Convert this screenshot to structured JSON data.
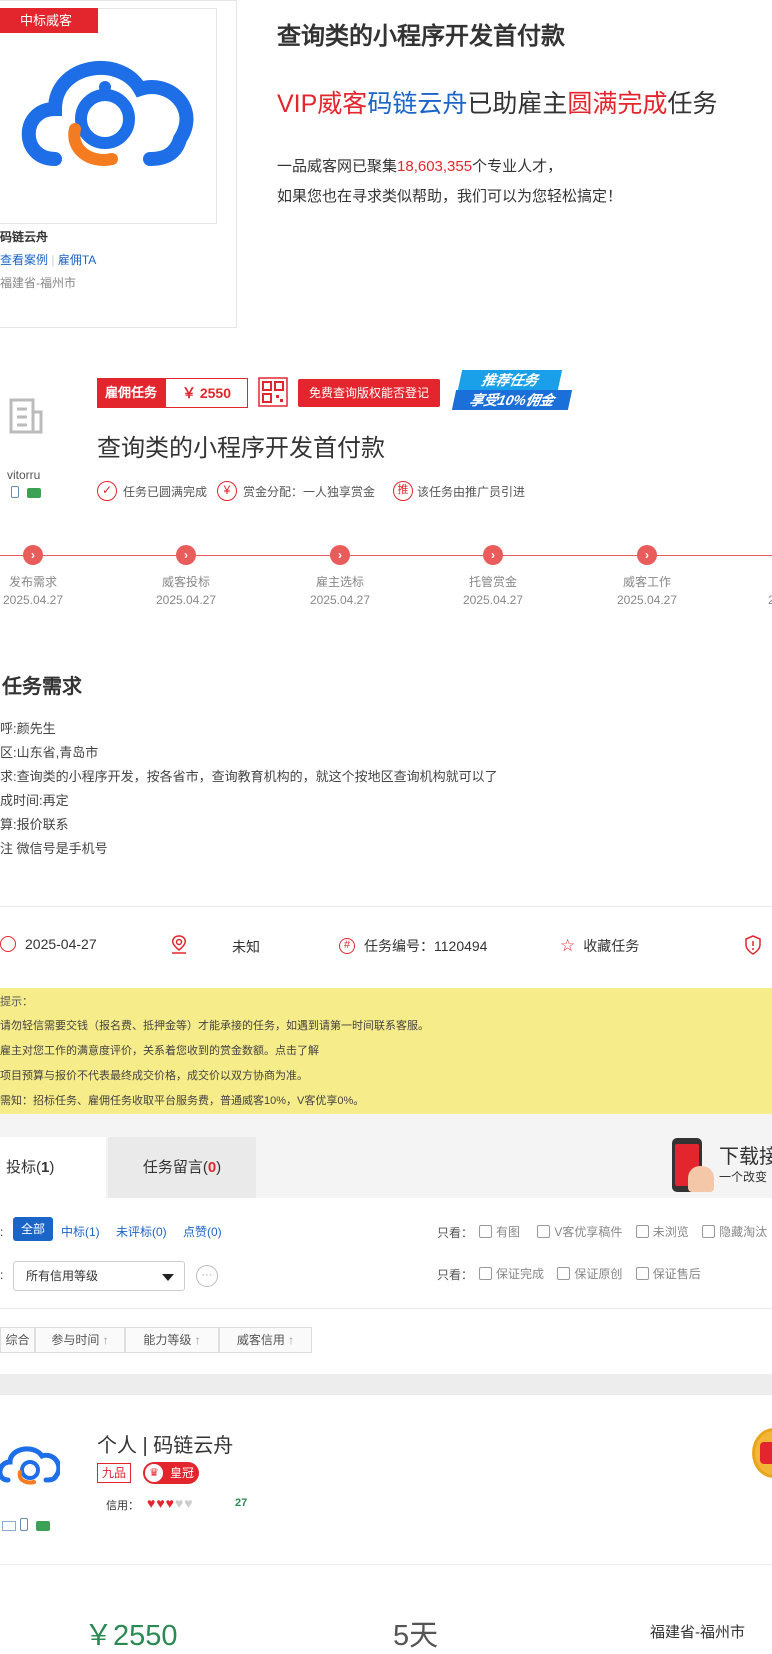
{
  "winner": {
    "badge": "中标威客",
    "name": "码链云舟",
    "view_cases": "查看案例",
    "separator": "|",
    "hire": "雇佣TA",
    "location": "福建省-福州市"
  },
  "promo": {
    "title": "查询类的小程序开发首付款",
    "line_parts": [
      "VIP",
      "威客",
      "码链云舟",
      "已助雇主",
      "圆满完成",
      "任务"
    ],
    "stat_prefix": "一品威客网已聚集",
    "stat_count": "18,603,355",
    "stat_suffix": "个专业人才，",
    "stat_line2": "如果您也在寻求类似帮助，我们可以为您轻松搞定！"
  },
  "task": {
    "type_label": "雇佣任务",
    "amount": "￥ 2550",
    "copyright_button": "免费查询版权能否登记",
    "recommend_line1": "推荐任务",
    "recommend_line2": "享受10%佣金",
    "title": "查询类的小程序开发首付款",
    "employer_name": "vitorru",
    "status_completed": "任务已圆满完成",
    "reward_prefix_icon": "¥",
    "reward_dist": "赏金分配：一人独享赏金",
    "promoter_icon_text": "推",
    "promoter_text": "该任务由推广员引进"
  },
  "steps": [
    {
      "label": "发布需求",
      "date": "2025.04.27"
    },
    {
      "label": "威客投标",
      "date": "2025.04.27"
    },
    {
      "label": "雇主选标",
      "date": "2025.04.27"
    },
    {
      "label": "托管赏金",
      "date": "2025.04.27"
    },
    {
      "label": "威客工作",
      "date": "2025.04.27"
    }
  ],
  "requirements": {
    "heading": "任务需求",
    "lines": [
      "呼:颜先生",
      "区:山东省,青岛市",
      "求:查询类的小程序开发，按各省市，查询教育机构的，就这个按地区查询机构就可以了",
      "成时间:再定",
      "算:报价联系",
      "注 微信号是手机号"
    ]
  },
  "meta": {
    "date": "2025-04-27",
    "location": "未知",
    "task_no": "任务编号：1120494",
    "favorite": "收藏任务"
  },
  "notice": {
    "title": "提示：",
    "lines": [
      "请勿轻信需要交钱（报名费、抵押金等）才能承接的任务，如遇到请第一时间联系客服。",
      "雇主对您工作的满意度评价，关系着您收到的赏金数额。点击了解",
      "项目预算与报价不代表最终成交价格，成交价以双方协商为准。",
      "需知：招标任务、雇佣任务收取平台服务费，普通威客10%，V客优享0%。"
    ]
  },
  "tabs": {
    "bids_label": "投标(",
    "bids_count": "1",
    "bids_close": ")",
    "comments_label": "任务留言(",
    "comments_count": "0",
    "comments_close": ")",
    "download_title": "下载接",
    "download_sub": "一个改变"
  },
  "filters": {
    "all": "全部",
    "won": "中标(1)",
    "unrated": "未评标(0)",
    "liked": "点赞(0)",
    "only_view": "只看：",
    "row1_options": [
      "有图",
      "V客优享稿件",
      "未浏览",
      "隐藏淘汰"
    ],
    "credit_select": "所有信用等级",
    "row2_options": [
      "保证完成",
      "保证原创",
      "保证售后"
    ],
    "more_icon": "···"
  },
  "sort": {
    "columns": [
      "综合",
      "参与时间",
      "能力等级",
      "威客信用"
    ]
  },
  "bid": {
    "name": "个人 | 码链云舟",
    "level": "九品",
    "crown": "皇冠",
    "credit_label": "信用：",
    "credit_score": "27",
    "credit_hearts_filled": 3,
    "credit_hearts_total": 5,
    "price": "￥2550",
    "duration": "5天",
    "location": "福建省-福州市"
  },
  "colors": {
    "brand_red": "#e3262e",
    "link_blue": "#1b64c8",
    "notice_bg": "#f7ec8a",
    "price_green": "#2b8a53"
  }
}
